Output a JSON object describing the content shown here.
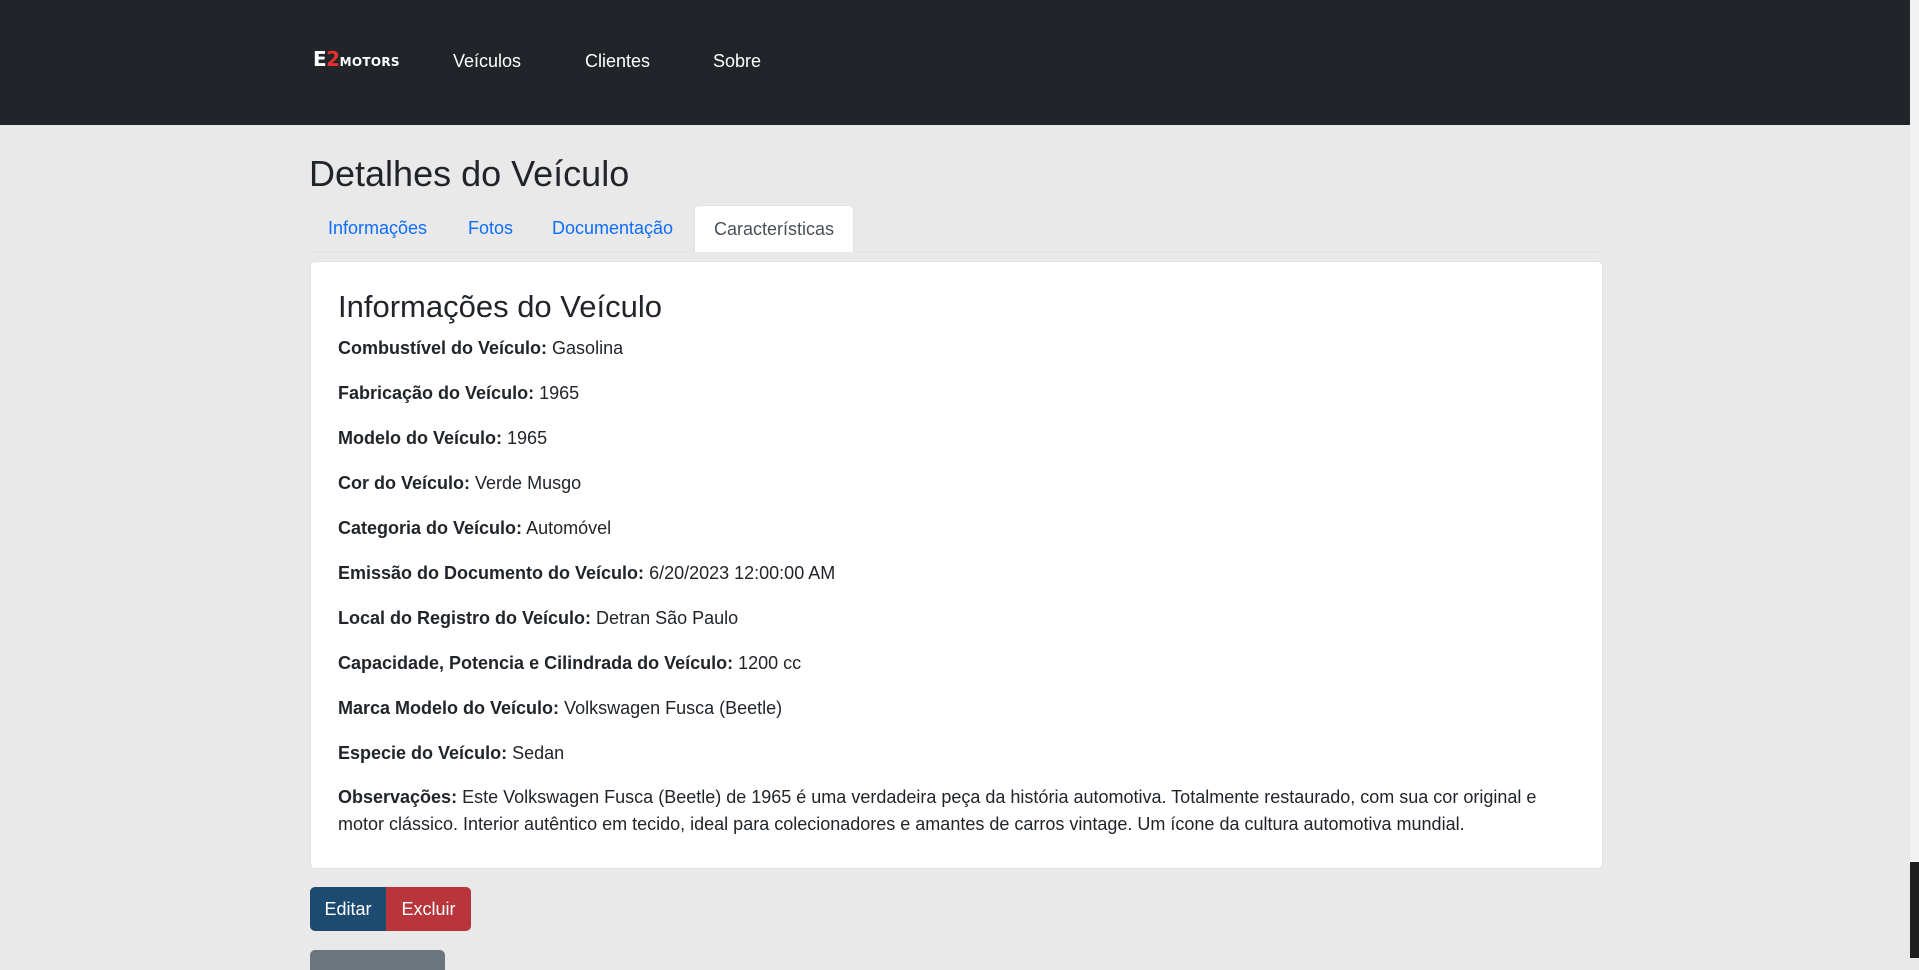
{
  "navbar": {
    "brand_e": "E",
    "brand_2": "2",
    "brand_motors": "MOTORS",
    "items": [
      {
        "label": "Veículos"
      },
      {
        "label": "Clientes"
      },
      {
        "label": "Sobre"
      }
    ]
  },
  "page": {
    "title": "Detalhes do Veículo"
  },
  "tabs": [
    {
      "label": "Informações"
    },
    {
      "label": "Fotos"
    },
    {
      "label": "Documentação"
    },
    {
      "label": "Características",
      "active": true
    }
  ],
  "card": {
    "title": "Informações do Veículo",
    "fields": [
      {
        "label": "Combustível do Veículo:",
        "value": "Gasolina"
      },
      {
        "label": "Fabricação do Veículo:",
        "value": "1965"
      },
      {
        "label": "Modelo do Veículo:",
        "value": "1965"
      },
      {
        "label": "Cor do Veículo:",
        "value": "Verde Musgo"
      },
      {
        "label": "Categoria do Veículo:",
        "value": "Automóvel"
      },
      {
        "label": "Emissão do Documento do Veículo:",
        "value": "6/20/2023 12:00:00 AM"
      },
      {
        "label": "Local do Registro do Veículo:",
        "value": "Detran São Paulo"
      },
      {
        "label": "Capacidade, Potencia e Cilindrada do Veículo:",
        "value": "1200 cc"
      },
      {
        "label": "Marca Modelo do Veículo:",
        "value": "Volkswagen Fusca (Beetle)"
      },
      {
        "label": "Especie do Veículo:",
        "value": "Sedan"
      }
    ],
    "observations": {
      "label": "Observações:",
      "value": "Este Volkswagen Fusca (Beetle) de 1965 é uma verdadeira peça da história automotiva. Totalmente restaurado, com sua cor original e motor clássico. Interior autêntico em tecido, ideal para colecionadores e amantes de carros vintage. Um ícone da cultura automotiva mundial."
    }
  },
  "actions": {
    "edit_label": "Editar",
    "delete_label": "Excluir"
  },
  "colors": {
    "navbar_bg": "#212529",
    "page_bg": "#e9e9e9",
    "link": "#0d6efd",
    "edit_button": "#1c4a70",
    "delete_button": "#b8353b",
    "back_button": "#6c757d",
    "brand_accent": "#e5302b"
  }
}
